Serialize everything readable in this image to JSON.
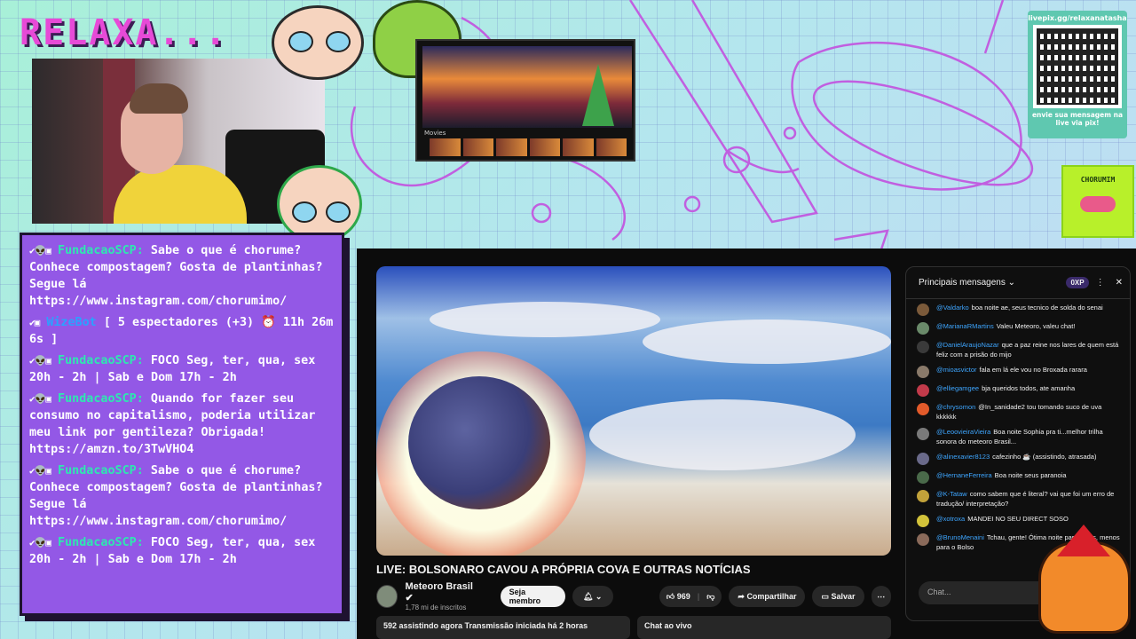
{
  "overlay": {
    "brand_title": "RELAXA...",
    "accent_color": "#e74ad7",
    "panel_color": "#9358e6"
  },
  "qr": {
    "url": "livepix.gg/relaxanatasha",
    "caption": "envie sua mensagem na live via pix!"
  },
  "chorume_logo": {
    "name": "CHORUMIM"
  },
  "twitch_chat": {
    "messages": [
      {
        "badges": "✔👽▣",
        "user": "FundacaoSCP:",
        "text": "Sabe o que é chorume? Conhece compostagem? Gosta de plantinhas? Segue lá https://www.instagram.com/chorumimo/"
      },
      {
        "badges": "✔▣",
        "user": "WizeBot",
        "text": "[ 5 espectadores (+3) ⏰ 11h 26m 6s ]"
      },
      {
        "badges": "✔👽▣",
        "user": "FundacaoSCP:",
        "text": "FOCO Seg, ter, qua, sex 20h - 2h | Sab e Dom 17h - 2h"
      },
      {
        "badges": "✔👽▣",
        "user": "FundacaoSCP:",
        "text": "Quando for fazer seu consumo no capitalismo, poderia utilizar meu link por gentileza? Obrigada! https://amzn.to/3TwVHO4"
      },
      {
        "badges": "✔👽▣",
        "user": "FundacaoSCP:",
        "text": "Sabe o que é chorume? Conhece compostagem? Gosta de plantinhas? Segue lá https://www.instagram.com/chorumimo/"
      },
      {
        "badges": "✔👽▣",
        "user": "FundacaoSCP:",
        "text": "FOCO Seg, ter, qua, sex 20h - 2h | Sab e Dom 17h - 2h"
      }
    ]
  },
  "movie_window": {
    "label": "Movies"
  },
  "youtube": {
    "video_title": "LIVE: BOLSONARO CAVOU A PRÓPRIA COVA E OUTRAS NOTÍCIAS",
    "channel_name": "Meteoro Brasil ✔",
    "channel_subs": "1,78 mi de inscritos",
    "join_label": "Seja membro",
    "likes": "969",
    "share_label": "Compartilhar",
    "save_label": "Salvar",
    "stats": "592 assistindo agora  Transmissão iniciada há 2 horas",
    "chat_ao_vivo": "Chat ao vivo",
    "chat": {
      "header_label": "Principais mensagens",
      "xp_badge": "0XP",
      "input_placeholder": "Chat...",
      "messages": [
        {
          "author": "@Valdarko",
          "text": "boa noite ae, seus tecnico de solda do senai",
          "color": "#7b5a3a"
        },
        {
          "author": "@MarianaRMartins",
          "text": "Valeu Meteoro, valeu chat!",
          "color": "#6a8a6a"
        },
        {
          "author": "@DanielAraujoNazar",
          "text": "que a paz reine nos lares de quem está feliz com a prisão do mijo",
          "color": "#3a3a3a"
        },
        {
          "author": "@mioasvictor",
          "text": "fala em lá ele vou no Broxada rarara",
          "color": "#8a7a6a"
        },
        {
          "author": "@elliegamgee",
          "text": "bja queridos todos, ate amanha",
          "color": "#c23a4a"
        },
        {
          "author": "@chrysomon",
          "text": "@In_sanidade2 tou tomando suco de uva kkkkkk",
          "color": "#e25a2a"
        },
        {
          "author": "@LeoovieiraVieira",
          "text": "Boa noite Sophia pra ti...melhor trilha sonora do meteoro Brasil...",
          "color": "#7a7a7a"
        },
        {
          "author": "@alinexavier8123",
          "text": "cafezinho ☕ (assistindo, atrasada)",
          "color": "#6a6a8a"
        },
        {
          "author": "@HernaneFerreira",
          "text": "Boa noite seus paranoia",
          "color": "#4a6a4a"
        },
        {
          "author": "@K-Tataw",
          "text": "como sabem que é literal? vai que foi um erro de tradução/ interpretação?",
          "color": "#c2a23a"
        },
        {
          "author": "@xotroxa",
          "text": "MANDEI NO SEU DIRECT SOSO",
          "color": "#d2c23a"
        },
        {
          "author": "@BrunoMenaini",
          "text": "Tchau, gente! Ótima noite para todos, menos para o Bolso",
          "color": "#8a6a5a"
        }
      ]
    }
  }
}
